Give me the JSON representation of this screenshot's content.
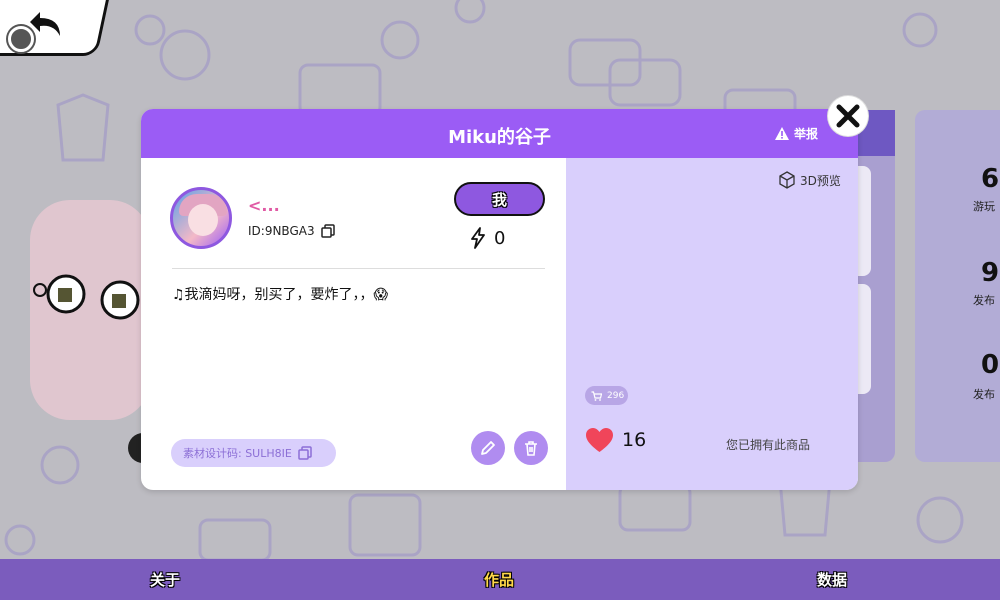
{
  "modal": {
    "title": "Miku的谷子",
    "report_label": "举报",
    "user": {
      "name": "<...",
      "id": "ID:9NBGA3"
    },
    "me_button": "我",
    "energy_count": "0",
    "description": "♫我滴妈呀，别买了，要炸了，，😱",
    "design_code": "素材设计码: SULH8IE",
    "preview_3d_label": "3D预览",
    "cart_count": "296",
    "likes": "16",
    "owned_text": "您已拥有此商品"
  },
  "background_stats": [
    {
      "value": "6",
      "label": "游玩"
    },
    {
      "value": "9",
      "label": "发布"
    },
    {
      "value": "0",
      "label": "发布"
    }
  ],
  "bottom_nav": [
    {
      "label": "关于",
      "active": false
    },
    {
      "label": "作品",
      "active": true
    },
    {
      "label": "数据",
      "active": false
    }
  ],
  "colors": {
    "header": "#9b5cf5",
    "bottom_nav": "#7b5cbd",
    "like_heart": "#f0455a",
    "active_tab": "#ffd84a"
  },
  "icons": [
    "back-arrow-icon",
    "close-icon",
    "warning-icon",
    "copy-icon",
    "lightning-icon",
    "cube-icon",
    "cart-icon",
    "heart-icon",
    "pencil-icon",
    "trash-icon"
  ]
}
